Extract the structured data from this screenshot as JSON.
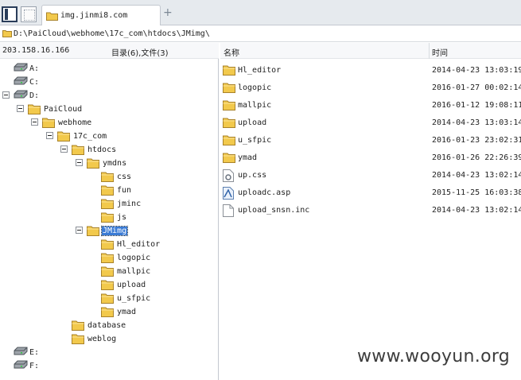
{
  "tab": {
    "title": "img.jinmi8.com",
    "add_label": "+"
  },
  "path": "D:\\PaiCloud\\webhome\\17c_com\\htdocs\\JMimg\\",
  "left_header": {
    "ip": "203.158.16.166",
    "counts": "目录(6),文件(3)"
  },
  "tree": [
    {
      "label": "A:",
      "icon": "drive-icon",
      "expand": false
    },
    {
      "label": "C:",
      "icon": "drive-icon",
      "expand": false
    },
    {
      "label": "D:",
      "icon": "drive-icon",
      "expand": true
    },
    {
      "label": "PaiCloud",
      "icon": "folder-icon",
      "expand": true
    },
    {
      "label": "webhome",
      "icon": "folder-icon",
      "expand": true
    },
    {
      "label": "17c_com",
      "icon": "folder-icon",
      "expand": true
    },
    {
      "label": "htdocs",
      "icon": "folder-icon",
      "expand": true
    },
    {
      "label": "ymdns",
      "icon": "folder-icon",
      "expand": true
    },
    {
      "label": "css",
      "icon": "folder-icon",
      "expand": false
    },
    {
      "label": "fun",
      "icon": "folder-icon",
      "expand": false
    },
    {
      "label": "jminc",
      "icon": "folder-icon",
      "expand": false
    },
    {
      "label": "js",
      "icon": "folder-icon",
      "expand": false
    },
    {
      "label": "JMimg",
      "icon": "folder-icon",
      "expand": true,
      "selected": true
    },
    {
      "label": "Hl_editor",
      "icon": "folder-icon",
      "expand": false
    },
    {
      "label": "logopic",
      "icon": "folder-icon",
      "expand": false
    },
    {
      "label": "mallpic",
      "icon": "folder-icon",
      "expand": false
    },
    {
      "label": "upload",
      "icon": "folder-icon",
      "expand": false
    },
    {
      "label": "u_sfpic",
      "icon": "folder-icon",
      "expand": false
    },
    {
      "label": "ymad",
      "icon": "folder-icon",
      "expand": false
    },
    {
      "label": "database",
      "icon": "folder-icon",
      "expand": false
    },
    {
      "label": "weblog",
      "icon": "folder-icon",
      "expand": false
    },
    {
      "label": "E:",
      "icon": "drive-icon",
      "expand": false
    },
    {
      "label": "F:",
      "icon": "drive-icon",
      "expand": false
    }
  ],
  "list_header": {
    "name": "名称",
    "time": "时间"
  },
  "files": [
    {
      "name": "Hl_editor",
      "time": "2014-04-23 13:03:19",
      "icon": "folder-icon"
    },
    {
      "name": "logopic",
      "time": "2016-01-27 00:02:14",
      "icon": "folder-icon"
    },
    {
      "name": "mallpic",
      "time": "2016-01-12 19:08:11",
      "icon": "folder-icon"
    },
    {
      "name": "upload",
      "time": "2014-04-23 13:03:14",
      "icon": "folder-icon"
    },
    {
      "name": "u_sfpic",
      "time": "2016-01-23 23:02:31",
      "icon": "folder-icon"
    },
    {
      "name": "ymad",
      "time": "2016-01-26 22:26:39",
      "icon": "folder-icon"
    },
    {
      "name": "up.css",
      "time": "2014-04-23 13:02:14",
      "icon": "css-file-icon"
    },
    {
      "name": "uploadc.asp",
      "time": "2015-11-25 16:03:38",
      "icon": "asp-file-icon"
    },
    {
      "name": "upload_snsn.inc",
      "time": "2014-04-23 13:02:14",
      "icon": "generic-file-icon"
    }
  ],
  "watermark": "www.wooyun.org",
  "colors": {
    "folder": "#f2c94c",
    "selection": "#3a7bd5"
  }
}
